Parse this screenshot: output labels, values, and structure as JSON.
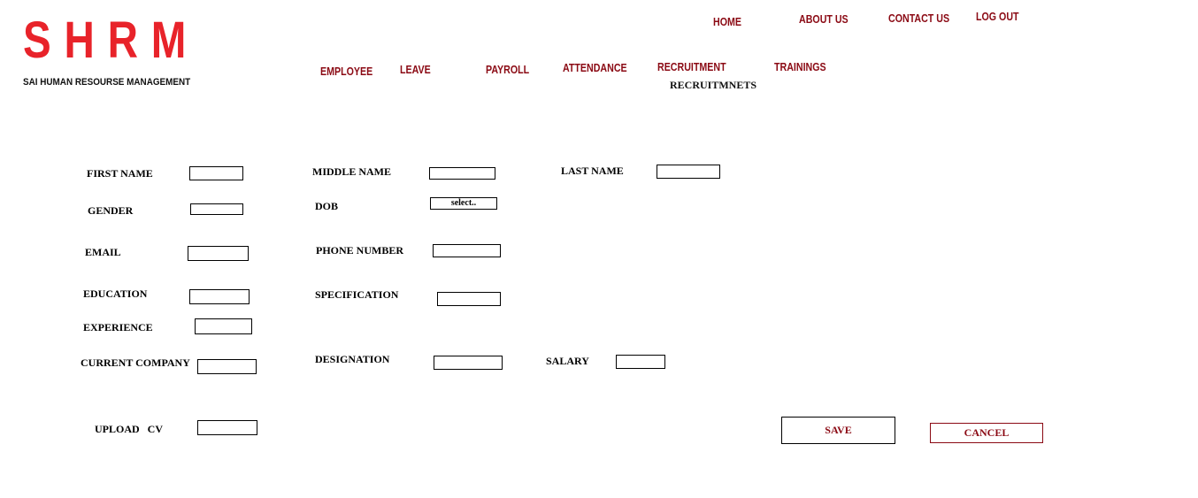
{
  "brand": {
    "logo": "SHRM",
    "tagline": "SAI HUMAN RESOURSE MANAGEMENT"
  },
  "top_nav": {
    "home": "HOME",
    "about": "ABOUT US",
    "contact": "CONTACT US",
    "logout": "LOG OUT"
  },
  "main_nav": {
    "employee": "EMPLOYEE",
    "leave": "LEAVE",
    "payroll": "PAYROLL",
    "attendance": "ATTENDANCE",
    "recruitment": "RECRUITMENT",
    "recruitment_sub": "RECRUITMNETS",
    "trainings": "TRAININGS"
  },
  "form": {
    "first_name": {
      "label": "FIRST NAME",
      "value": ""
    },
    "middle_name": {
      "label": "MIDDLE NAME",
      "value": ""
    },
    "last_name": {
      "label": "LAST NAME",
      "value": ""
    },
    "gender": {
      "label": "GENDER",
      "value": ""
    },
    "dob": {
      "label": "DOB",
      "selected": "select.."
    },
    "email": {
      "label": "EMAIL",
      "value": ""
    },
    "phone": {
      "label": "PHONE NUMBER",
      "value": ""
    },
    "education": {
      "label": "EDUCATION",
      "value": ""
    },
    "specification": {
      "label": "SPECIFICATION",
      "value": ""
    },
    "experience": {
      "label": "EXPERIENCE",
      "value": ""
    },
    "current_company": {
      "label": "CURRENT COMPANY",
      "value": ""
    },
    "designation": {
      "label": "DESIGNATION",
      "value": ""
    },
    "salary": {
      "label": "SALARY",
      "value": ""
    },
    "upload_cv": {
      "label": "UPLOAD   CV",
      "value": ""
    }
  },
  "actions": {
    "save": "SAVE",
    "cancel": "CANCEL"
  },
  "colors": {
    "logo_red": "#e8232a",
    "nav_maroon": "#8b0a14"
  }
}
